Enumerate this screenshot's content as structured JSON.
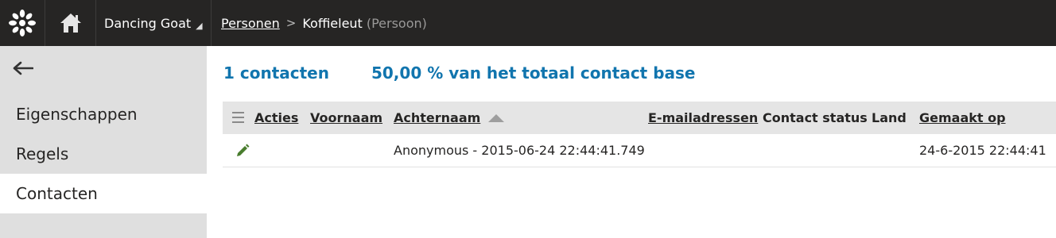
{
  "header": {
    "site_name": "Dancing Goat",
    "breadcrumb": {
      "parent": "Personen",
      "separator": ">",
      "current": "Koffieleut",
      "type": "(Persoon)"
    }
  },
  "sidebar": {
    "items": [
      {
        "label": "Eigenschappen",
        "active": false
      },
      {
        "label": "Regels",
        "active": false
      },
      {
        "label": "Contacten",
        "active": true
      }
    ]
  },
  "summary": {
    "count": "1 contacten",
    "percent": "50,00 % van het totaal contact base"
  },
  "table": {
    "columns": [
      "Acties",
      "Voornaam",
      "Achternaam",
      "E-mailadressen",
      "Contact status",
      "Land",
      "Gemaakt op"
    ],
    "rows": [
      {
        "voornaam": "",
        "achternaam": "Anonymous - 2015-06-24 22:44:41.749",
        "email": "",
        "status": "",
        "land": "",
        "gemaakt_op": "24-6-2015 22:44:41"
      }
    ]
  },
  "colors": {
    "topbar": "#262524",
    "accent": "#1175ae",
    "edit_icon": "#497d2e",
    "sidebar_bg": "#dfdfdf"
  }
}
